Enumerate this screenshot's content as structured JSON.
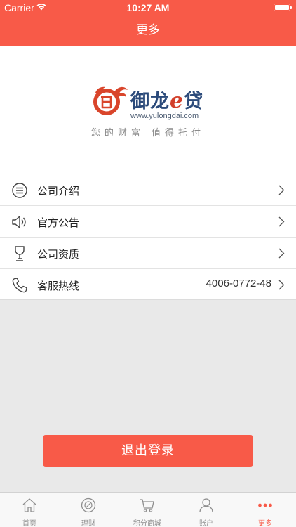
{
  "status_bar": {
    "carrier": "Carrier",
    "time": "10:27 AM"
  },
  "nav": {
    "title": "更多"
  },
  "brand": {
    "name_prefix": "御龙",
    "name_e": "e",
    "name_suffix": "贷",
    "url": "www.yulongdai.com",
    "slogan": "您的财富 值得托付"
  },
  "menu": {
    "items": [
      {
        "label": "公司介绍",
        "value": ""
      },
      {
        "label": "官方公告",
        "value": ""
      },
      {
        "label": "公司资质",
        "value": ""
      },
      {
        "label": "客服热线",
        "value": "4006-0772-48"
      }
    ]
  },
  "logout": {
    "label": "退出登录"
  },
  "tabs": [
    {
      "label": "首页"
    },
    {
      "label": "理财"
    },
    {
      "label": "积分商城"
    },
    {
      "label": "账户"
    },
    {
      "label": "更多"
    }
  ],
  "colors": {
    "accent": "#f85a48",
    "brand_blue": "#2b4a7a"
  }
}
